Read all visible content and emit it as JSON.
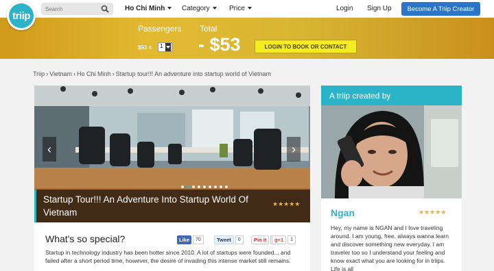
{
  "nav": {
    "logo_text": "triip",
    "search_placeholder": "Search",
    "location": "Ho Chi Minh",
    "category": "Category",
    "price": "Price",
    "login": "Login",
    "signup": "Sign Up",
    "creator_button": "Become A Triip Creator"
  },
  "booking": {
    "passengers_label": "Passengers",
    "total_label": "Total",
    "price_each": "$53 x",
    "quantity": "1",
    "total_amount": "- $53",
    "book_button": "LOGIN TO BOOK OR CONTACT"
  },
  "breadcrumb": {
    "items": [
      "Triip",
      "Vietnam",
      "Ho Chi Minh",
      "Startup tour!!! An adventure into startup world of Vietnam"
    ],
    "separator": "›"
  },
  "tour": {
    "title": "Startup Tour!!! An Adventure Into Startup World Of Vietnam",
    "rating": "★★★★★",
    "prev_arrow": "‹",
    "next_arrow": "›",
    "slide_count": 9,
    "active_slide": 1
  },
  "special": {
    "heading": "What's so special?",
    "share": {
      "facebook_label": "Like",
      "facebook_count": "70",
      "twitter_label": "Tweet",
      "twitter_count": "0",
      "pinterest_label": "Pin it",
      "pinterest_count": "0",
      "gplus_label": "g+1",
      "gplus_count": "1"
    },
    "description": "Startup in technology industry has been hotter since 2010. A lot of startups were founded... and failed after a short period time, however, the desire of invading this intense market still remains."
  },
  "creator": {
    "heading": "A triip created by",
    "name": "Ngan",
    "rating": "★★★★★",
    "bio": "Hey, my name is NGAN and I love traveling around. I am young, free, always wanna learn and discover something new everyday. I am traveler too so I understand your feeling and know exact what you are looking for in triips. Life is all"
  },
  "colors": {
    "brand": "#2bb3c8",
    "creator_button": "#2a75c9",
    "book_button": "#f3ec21",
    "star": "#f0b323"
  }
}
